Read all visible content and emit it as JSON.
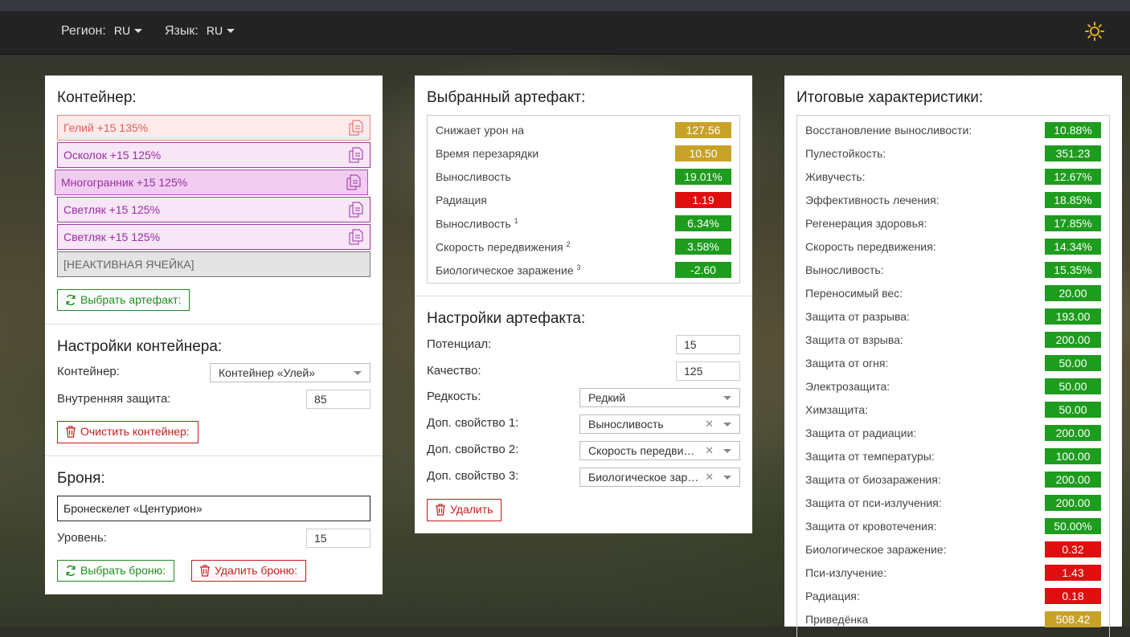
{
  "topbar": {
    "region_label": "Регион:",
    "region_value": "RU",
    "lang_label": "Язык:",
    "lang_value": "RU"
  },
  "container": {
    "title": "Контейнер:",
    "slots": [
      {
        "label": "Гелий +15 135%"
      },
      {
        "label": "Осколок +15 125%"
      },
      {
        "label": "Многогранник +15 125%"
      },
      {
        "label": "Светляк +15 125%"
      },
      {
        "label": "Светляк +15 125%"
      },
      {
        "label": "[НЕАКТИВНАЯ ЯЧЕЙКА]"
      }
    ],
    "select_button": "Выбрать артефакт:"
  },
  "container_settings": {
    "title": "Настройки контейнера:",
    "container_label": "Контейнер:",
    "container_value": "Контейнер «Улей»",
    "protection_label": "Внутренняя защита:",
    "protection_value": "85",
    "clear_button": "Очистить контейнер:"
  },
  "armor": {
    "title": "Броня:",
    "name": "Бронескелет «Центурион»",
    "level_label": "Уровень:",
    "level_value": "15",
    "select_button": "Выбрать броню:",
    "delete_button": "Удалить броню:"
  },
  "artifact": {
    "title": "Выбранный артефакт:",
    "stats": [
      {
        "name": "Снижает урон на",
        "sup": "",
        "value": "127.56",
        "color": "y"
      },
      {
        "name": "Время перезарядки",
        "sup": "",
        "value": "10.50",
        "color": "y"
      },
      {
        "name": "Выносливость",
        "sup": "",
        "value": "19.01%",
        "color": "g"
      },
      {
        "name": "Радиация",
        "sup": "",
        "value": "1.19",
        "color": "r"
      },
      {
        "name": "Выносливость",
        "sup": "1",
        "value": "6.34%",
        "color": "g"
      },
      {
        "name": "Скорость передвижения",
        "sup": "2",
        "value": "3.58%",
        "color": "g"
      },
      {
        "name": "Биологическое заражение",
        "sup": "3",
        "value": "-2.60",
        "color": "g"
      }
    ]
  },
  "artifact_settings": {
    "title": "Настройки артефакта:",
    "potential_label": "Потенциал:",
    "potential_value": "15",
    "quality_label": "Качество:",
    "quality_value": "125",
    "rarity_label": "Редкость:",
    "rarity_value": "Редкий",
    "prop1_label": "Доп. свойство 1:",
    "prop1_value": "Выносливость",
    "prop2_label": "Доп. свойство 2:",
    "prop2_value": "Скорость передвижения",
    "prop3_label": "Доп. свойство 3:",
    "prop3_value": "Биологическое заражение",
    "delete_button": "Удалить"
  },
  "totals": {
    "title": "Итоговые характеристики:",
    "stats": [
      {
        "name": "Восстановление выносливости:",
        "value": "10.88%",
        "color": "g"
      },
      {
        "name": "Пулестойкость:",
        "value": "351.23",
        "color": "g"
      },
      {
        "name": "Живучесть:",
        "value": "12.67%",
        "color": "g"
      },
      {
        "name": "Эффективность лечения:",
        "value": "18.85%",
        "color": "g"
      },
      {
        "name": "Регенерация здоровья:",
        "value": "17.85%",
        "color": "g"
      },
      {
        "name": "Скорость передвижения:",
        "value": "14.34%",
        "color": "g"
      },
      {
        "name": "Выносливость:",
        "value": "15.35%",
        "color": "g"
      },
      {
        "name": "Переносимый вес:",
        "value": "20.00",
        "color": "g"
      },
      {
        "name": "Защита от разрыва:",
        "value": "193.00",
        "color": "g"
      },
      {
        "name": "Защита от взрыва:",
        "value": "200.00",
        "color": "g"
      },
      {
        "name": "Защита от огня:",
        "value": "50.00",
        "color": "g"
      },
      {
        "name": "Электрозащита:",
        "value": "50.00",
        "color": "g"
      },
      {
        "name": "Химзащита:",
        "value": "50.00",
        "color": "g"
      },
      {
        "name": "Защита от радиации:",
        "value": "200.00",
        "color": "g"
      },
      {
        "name": "Защита от температуры:",
        "value": "100.00",
        "color": "g"
      },
      {
        "name": "Защита от биозаражения:",
        "value": "200.00",
        "color": "g"
      },
      {
        "name": "Защита от пси-излучения:",
        "value": "200.00",
        "color": "g"
      },
      {
        "name": "Защита от кровотечения:",
        "value": "50.00%",
        "color": "g"
      },
      {
        "name": "Биологическое заражение:",
        "value": "0.32",
        "color": "r"
      },
      {
        "name": "Пси-излучение:",
        "value": "1.43",
        "color": "r"
      },
      {
        "name": "Радиация:",
        "value": "0.18",
        "color": "r"
      },
      {
        "name": "Приведёнка",
        "value": "508.42",
        "color": "y"
      }
    ]
  }
}
